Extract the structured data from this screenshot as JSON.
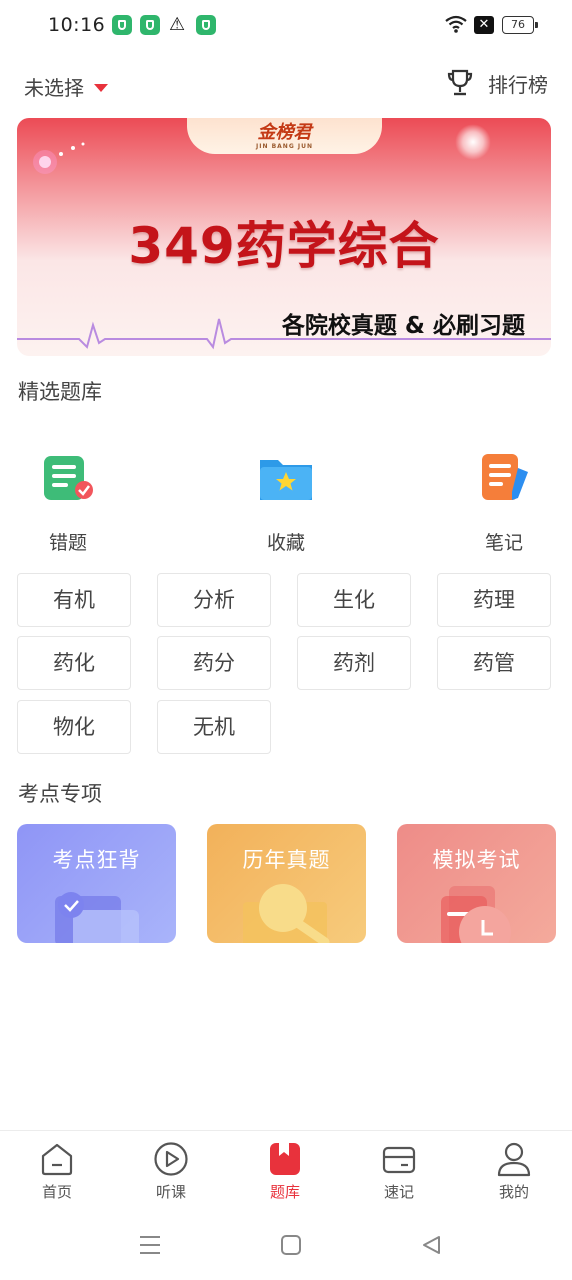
{
  "status_bar": {
    "time": "10:16",
    "battery": "76"
  },
  "header": {
    "subject_select": "未选择",
    "ranking_label": "排行榜"
  },
  "banner": {
    "brand": "金榜君",
    "brand_sub": "JIN BANG JUN",
    "title": "349药学综合",
    "subtitle": "各院校真题 & 必刷习题"
  },
  "featured": {
    "title": "精选题库",
    "items": [
      {
        "label": "错题",
        "icon": "wrong-answers-icon"
      },
      {
        "label": "收藏",
        "icon": "favorites-folder-icon"
      },
      {
        "label": "笔记",
        "icon": "notes-icon"
      }
    ],
    "subjects": [
      "有机",
      "分析",
      "生化",
      "药理",
      "药化",
      "药分",
      "药剂",
      "药管",
      "物化",
      "无机"
    ]
  },
  "special": {
    "title": "考点专项",
    "cards": [
      {
        "label": "考点狂背",
        "color": "#8f95f6"
      },
      {
        "label": "历年真题",
        "color": "#f2b15a"
      },
      {
        "label": "模拟考试",
        "color": "#ee8c88"
      }
    ]
  },
  "bottom_nav": [
    {
      "label": "首页",
      "icon": "home-icon",
      "active": false
    },
    {
      "label": "听课",
      "icon": "play-icon",
      "active": false
    },
    {
      "label": "题库",
      "icon": "question-bank-icon",
      "active": true
    },
    {
      "label": "速记",
      "icon": "card-icon",
      "active": false
    },
    {
      "label": "我的",
      "icon": "profile-icon",
      "active": false
    }
  ],
  "colors": {
    "accent": "#e8323c"
  }
}
